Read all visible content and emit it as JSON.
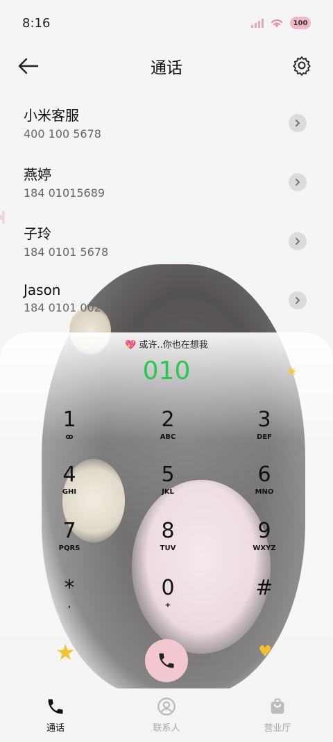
{
  "status_bar": {
    "time": "8:16",
    "battery": "100"
  },
  "header": {
    "title": "通话"
  },
  "recent_calls": [
    {
      "name": "小米客服",
      "number": "400 100 5678"
    },
    {
      "name": "燕婷",
      "number": "184 01015689"
    },
    {
      "name": "子玲",
      "number": "184 0101 5678"
    },
    {
      "name": "Jason",
      "number": "184 0101 0029"
    }
  ],
  "dialer": {
    "motto": "或许..你也在想我",
    "entry": "010",
    "keys": [
      {
        "digit": "1",
        "letters": "ꝏ"
      },
      {
        "digit": "2",
        "letters": "ABC"
      },
      {
        "digit": "3",
        "letters": "DEF"
      },
      {
        "digit": "4",
        "letters": "GHI"
      },
      {
        "digit": "5",
        "letters": "JKL"
      },
      {
        "digit": "6",
        "letters": "MNO"
      },
      {
        "digit": "7",
        "letters": "PQRS"
      },
      {
        "digit": "8",
        "letters": "TUV"
      },
      {
        "digit": "9",
        "letters": "WXYZ"
      },
      {
        "digit": "*",
        "letters": ","
      },
      {
        "digit": "0",
        "letters": "+"
      },
      {
        "digit": "#",
        "letters": ""
      }
    ]
  },
  "bottom_nav": [
    {
      "label": "通话",
      "icon": "phone-icon",
      "active": true
    },
    {
      "label": "联系人",
      "icon": "contact-icon",
      "active": false
    },
    {
      "label": "营业厅",
      "icon": "store-icon",
      "active": false
    }
  ],
  "colors": {
    "accent_green": "#2ac64b",
    "call_button": "#f2c7d0",
    "battery": "#f2b7c6"
  }
}
